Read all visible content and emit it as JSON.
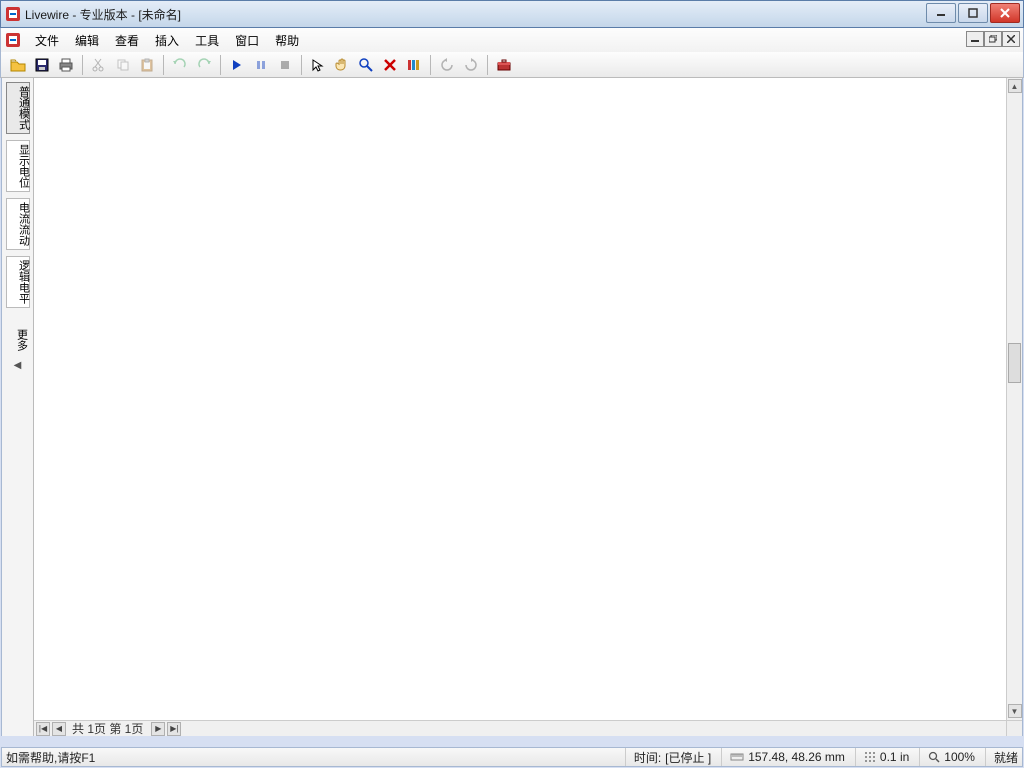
{
  "title": "Livewire - 专业版本   - [未命名]",
  "menu": {
    "file": "文件",
    "edit": "编辑",
    "view": "查看",
    "insert": "插入",
    "tool": "工具",
    "window": "窗口",
    "help": "帮助"
  },
  "palette": {
    "normal": "普通模式",
    "voltage": "显示电位",
    "current": "电流流动",
    "logic": "逻辑电平",
    "more": "更多"
  },
  "hscroll": {
    "page_label": "共 1页 第 1页"
  },
  "status": {
    "hint": "如需帮助,请按F1",
    "time_label": "时间:",
    "time_state": "[已停止 ]",
    "coords": "157.48, 48.26 mm",
    "grid": "0.1 in",
    "zoom": "100%",
    "ready": "就绪"
  }
}
